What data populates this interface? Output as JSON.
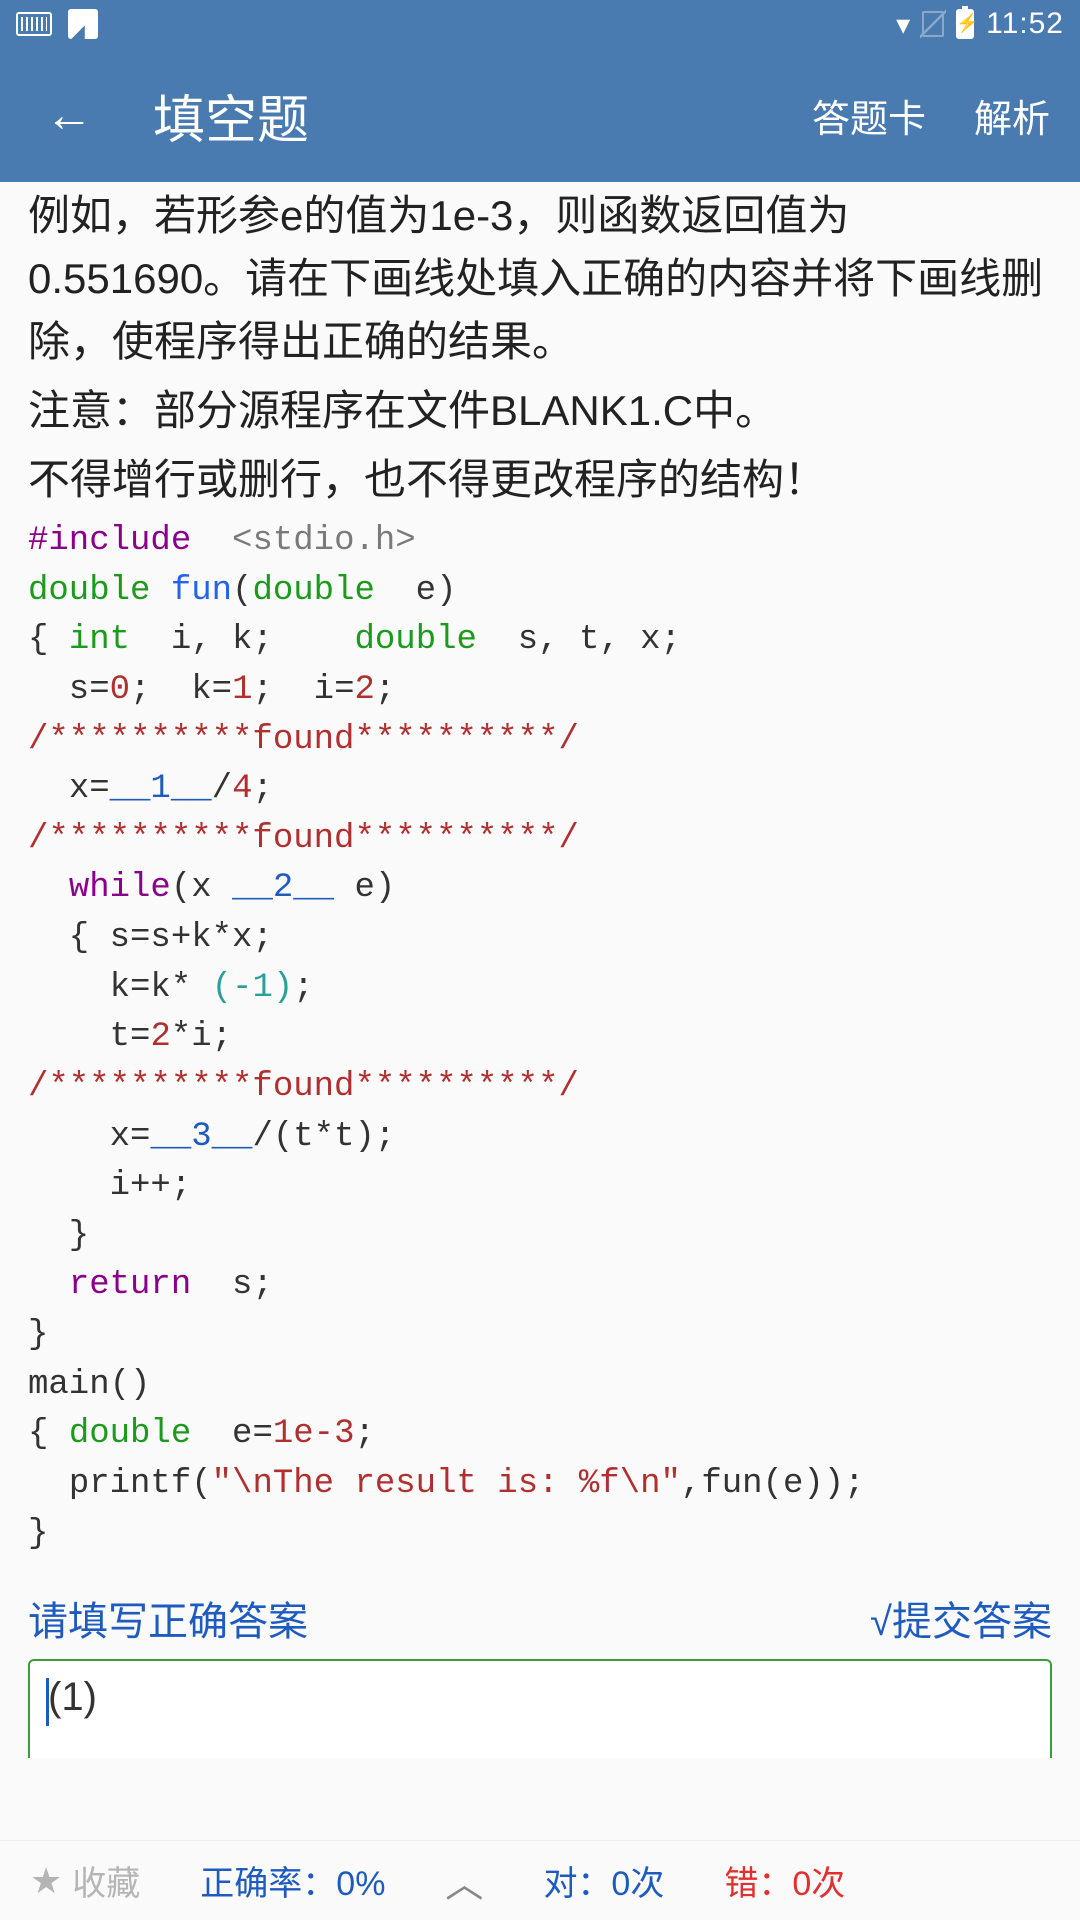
{
  "status": {
    "time": "11:52"
  },
  "header": {
    "title": "填空题",
    "action_card": "答题卡",
    "action_analysis": "解析"
  },
  "question": {
    "para1": "例如，若形参e的值为1e-3，则函数返回值为0.551690。请在下画线处填入正确的内容并将下画线删除，使程序得出正确的结果。",
    "para2": "注意：部分源程序在文件BLANK1.C中。",
    "para3": "不得增行或删行，也不得更改程序的结构！"
  },
  "code": {
    "include_kw": "#include",
    "include_hdr": "<stdio.h>",
    "double": "double",
    "fun": "fun",
    "int": "int",
    "vars1": "i, k;",
    "vars2": "s, t, x;",
    "init": "s=0;  k=1;  i=2;",
    "found": "/**********found**********/",
    "line_x": "x=",
    "blank1": "__1__",
    "div4": "/4;",
    "while": "while",
    "while_open": "(x ",
    "blank2": "__2__",
    "while_close": " e)",
    "body1": "s=s+k*x;",
    "body2": "k=k* ",
    "neg1": "(-1)",
    "semi": ";",
    "body3_t": "t=",
    "body3_2": "2",
    "body3_rest": "*i;",
    "line_x2": "x=",
    "blank3": "__3__",
    "tt": "/(t*t);",
    "ipp": "i++;",
    "return": "return",
    "ret_s": "s;",
    "main": "main()",
    "main_decl": "e=",
    "e_val": "1e-3",
    "printf": "printf",
    "str": "\"\\nThe result is: %f\\n\"",
    "printf_tail": ",fun(e));"
  },
  "answer": {
    "prompt": "请填写正确答案",
    "submit": "√提交答案",
    "input_value": "(1)"
  },
  "bottom": {
    "favorite": "收藏",
    "accuracy": "正确率：0%",
    "correct": "对：0次",
    "wrong": "错：0次"
  }
}
